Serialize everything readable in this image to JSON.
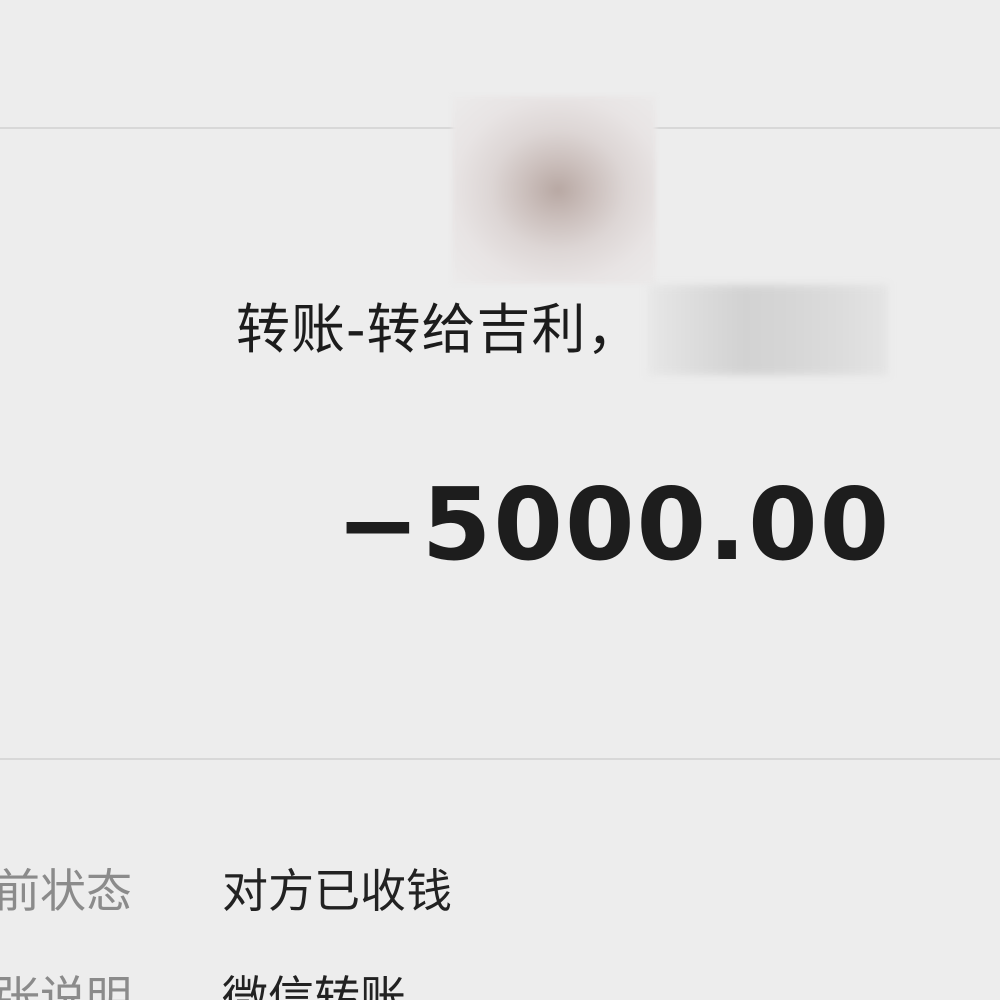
{
  "transfer": {
    "title": "转账-转给吉利，",
    "amount": "−5000.00"
  },
  "details": {
    "status": {
      "label": "前状态",
      "value": "对方已收钱"
    },
    "remark": {
      "label": "张说明",
      "value": "微信转账"
    }
  }
}
